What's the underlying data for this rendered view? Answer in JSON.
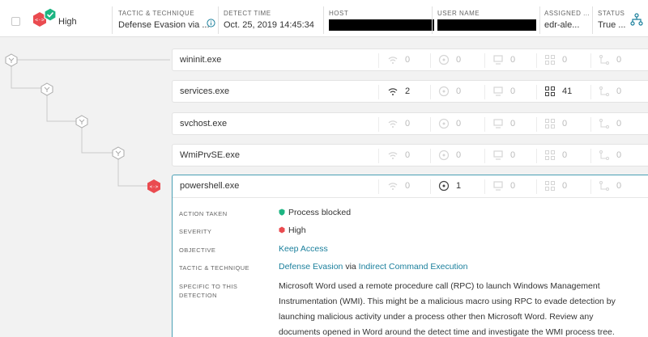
{
  "header": {
    "severity": "High",
    "columns": {
      "tactic": {
        "label": "TACTIC & TECHNIQUE",
        "value": "Defense Evasion via ..."
      },
      "detect_time": {
        "label": "DETECT TIME",
        "value": "Oct. 25, 2019 14:45:34"
      },
      "host": {
        "label": "HOST"
      },
      "user": {
        "label": "USER NAME"
      },
      "assigned": {
        "label": "ASSIGNED ...",
        "value": "edr-ale..."
      },
      "status": {
        "label": "STATUS",
        "value": "True ..."
      }
    }
  },
  "processes": [
    {
      "name": "wininit.exe",
      "m1": "0",
      "m2": "0",
      "m3": "0",
      "m4": "0",
      "m5": "0"
    },
    {
      "name": "services.exe",
      "m1": "2",
      "m2": "0",
      "m3": "0",
      "m4": "41",
      "m5": "0"
    },
    {
      "name": "svchost.exe",
      "m1": "0",
      "m2": "0",
      "m3": "0",
      "m4": "0",
      "m5": "0"
    },
    {
      "name": "WmiPrvSE.exe",
      "m1": "0",
      "m2": "0",
      "m3": "0",
      "m4": "0",
      "m5": "0"
    },
    {
      "name": "powershell.exe",
      "m1": "0",
      "m2": "1",
      "m3": "0",
      "m4": "0",
      "m5": "0"
    }
  ],
  "details": {
    "action_taken": {
      "label": "ACTION TAKEN",
      "value": "Process blocked"
    },
    "severity": {
      "label": "SEVERITY",
      "value": "High"
    },
    "objective": {
      "label": "OBJECTIVE",
      "value": "Keep Access"
    },
    "tactic": {
      "label": "TACTIC & TECHNIQUE",
      "tactic": "Defense Evasion",
      "via": "via",
      "technique": "Indirect Command Execution"
    },
    "specific": {
      "label": "SPECIFIC TO THIS DETECTION",
      "value": "Microsoft Word used a remote procedure call (RPC) to launch Windows Management Instrumentation (WMI). This might be a malicious macro using RPC to evade detection by launching malicious activity under a process other then Microsoft Word. Review any documents opened in Word around the detect time and investigate the WMI process tree."
    }
  },
  "colors": {
    "accent": "#1a7f9c",
    "severity_high": "#ea4b50",
    "action_green": "#1db582"
  }
}
